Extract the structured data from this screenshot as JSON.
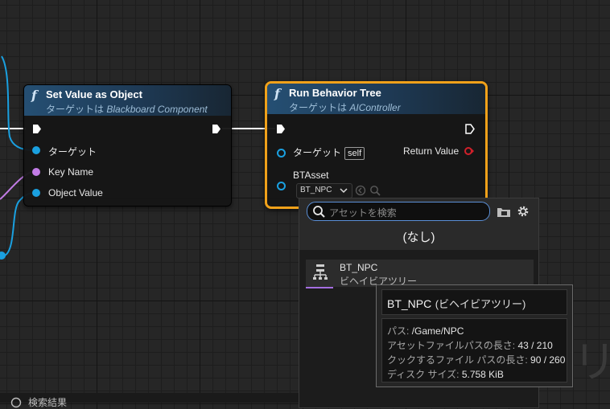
{
  "nodes": {
    "set_value": {
      "title": "Set Value as Object",
      "subtitle_prefix": "ターゲットは",
      "subtitle_target": "Blackboard Component",
      "pins": {
        "target": "ターゲット",
        "key_name": "Key Name",
        "object_value": "Object Value"
      }
    },
    "run_bt": {
      "title": "Run Behavior Tree",
      "subtitle_prefix": "ターゲットは",
      "subtitle_target": "AIController",
      "pins": {
        "target": "ターゲット",
        "self_badge": "self",
        "bt_asset": "BTAsset",
        "return_value": "Return Value"
      },
      "asset_combo_value": "BT_NPC"
    }
  },
  "asset_picker": {
    "search_placeholder": "アセットを検索",
    "none_option": "(なし)",
    "items": [
      {
        "name": "BT_NPC",
        "type": "ビヘイビアツリー"
      }
    ]
  },
  "tooltip": {
    "title": "BT_NPC",
    "type": "(ビヘイビアツリー)",
    "rows": [
      {
        "label": "パス:",
        "value": "/Game/NPC"
      },
      {
        "label": "アセットファイルパスの長さ:",
        "value": "43 / 210"
      },
      {
        "label": "クックするファイル パスの長さ:",
        "value": "90 / 260"
      },
      {
        "label": "ディスク サイズ:",
        "value": "5.758 KiB"
      }
    ]
  },
  "status_bar": {
    "text": "検索結果"
  },
  "colors": {
    "exec": "#ffffff",
    "object_pin": "#1aa0e0",
    "name_pin": "#c27ce6",
    "selection": "#f0a11a",
    "return_pin": "#d0202a",
    "asset_type_bar": "#a46ee0"
  }
}
